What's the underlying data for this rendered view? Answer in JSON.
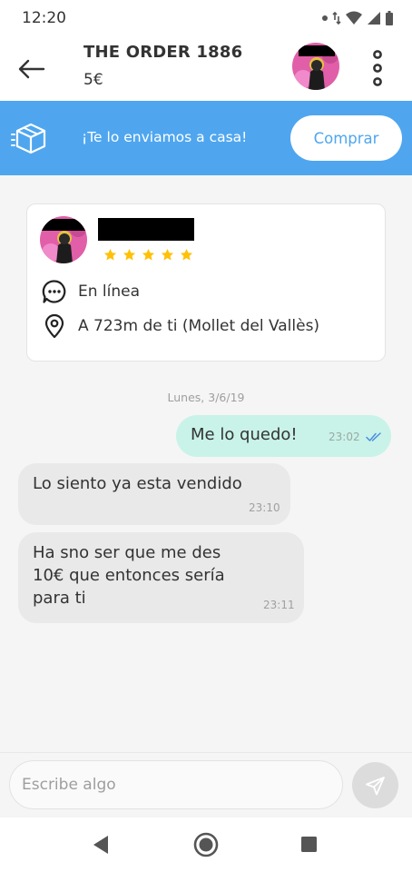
{
  "status_bar": {
    "time": "12:20",
    "icons": [
      "notification-dot-icon",
      "data-arrows-icon",
      "wifi-icon",
      "signal-icon",
      "battery-icon"
    ]
  },
  "header": {
    "title": "THE ORDER 1886",
    "price": "5€",
    "back_icon": "arrow-left-icon",
    "menu_icon": "more-vertical-icon"
  },
  "promo": {
    "icon": "box-icon",
    "text": "¡Te lo enviamos a casa!",
    "button_label": "Comprar",
    "background_color": "#4fa6ef"
  },
  "seller": {
    "rating_stars": 5,
    "star_color": "#ffc107",
    "online_icon": "chat-dots-icon",
    "online_text": "En línea",
    "location_icon": "location-pin-icon",
    "location_text": "A 723m de ti (Mollet del Vallès)"
  },
  "chat": {
    "date": "Lunes, 3/6/19",
    "messages": [
      {
        "direction": "out",
        "text": "Me lo quedo!",
        "time": "23:02",
        "status": "read"
      },
      {
        "direction": "in",
        "text": "Lo siento ya esta vendido",
        "time": "23:10"
      },
      {
        "direction": "in",
        "lines": [
          "Ha sno ser que me des",
          "10€ que entonces sería",
          "para ti"
        ],
        "time": "23:11"
      }
    ]
  },
  "composer": {
    "placeholder": "Escribe algo",
    "send_icon": "send-icon"
  },
  "nav_bar": {
    "icons": [
      "back-triangle-icon",
      "home-circle-icon",
      "recents-square-icon"
    ]
  }
}
